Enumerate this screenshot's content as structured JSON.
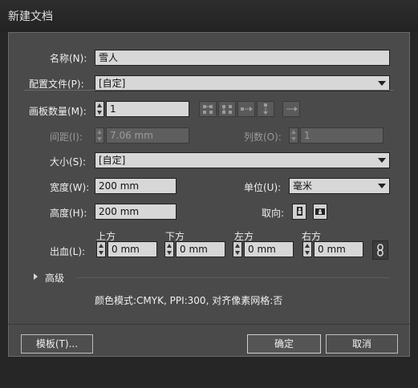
{
  "window": {
    "title": "新建文档"
  },
  "form": {
    "name_label": "名称(N):",
    "name_value": "雪人",
    "profile_label": "配置文件(P):",
    "profile_value": "[自定]",
    "artboards_label": "画板数量(M):",
    "artboards_value": "1",
    "spacing_label": "间距(I):",
    "spacing_value": "7.06 mm",
    "columns_label": "列数(O):",
    "columns_value": "1",
    "size_label": "大小(S):",
    "size_value": "[自定]",
    "width_label": "宽度(W):",
    "width_value": "200 mm",
    "units_label": "单位(U):",
    "units_value": "毫米",
    "height_label": "高度(H):",
    "height_value": "200 mm",
    "orientation_label": "取向:",
    "bleed_label": "出血(L):",
    "bleed_top_label": "上方",
    "bleed_top_value": "0 mm",
    "bleed_bottom_label": "下方",
    "bleed_bottom_value": "0 mm",
    "bleed_left_label": "左方",
    "bleed_left_value": "0 mm",
    "bleed_right_label": "右方",
    "bleed_right_value": "0 mm",
    "advanced_label": "高级",
    "info_text": "颜色模式:CMYK, PPI:300, 对齐像素网格:否"
  },
  "buttons": {
    "templates_label": "模板(T)...",
    "ok_label": "确定",
    "cancel_label": "取消"
  },
  "icons": {
    "arrange_buttons": [
      "grid-by-row-icon",
      "grid-by-column-icon",
      "arrange-by-row-icon",
      "arrange-by-column-icon",
      "change-layout-direction-icon"
    ],
    "orientation": [
      "portrait-icon",
      "landscape-icon"
    ],
    "link": "chain-link-icon",
    "expand": "triangle-right-icon"
  },
  "colors": {
    "panel": "#4a4a4a",
    "field": "#d7d7d7",
    "titlebar": "#262626"
  }
}
